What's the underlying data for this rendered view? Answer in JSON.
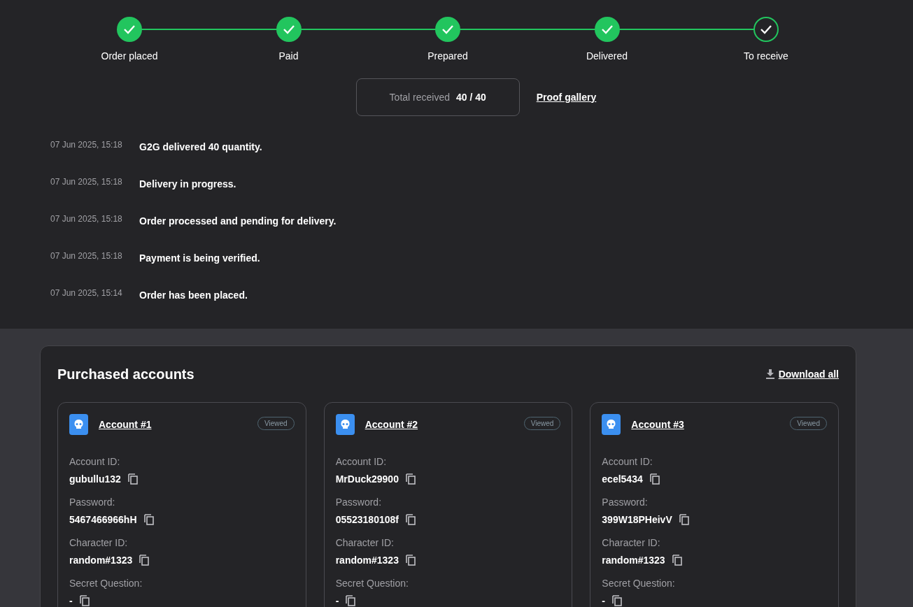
{
  "steps": [
    {
      "label": "Order placed",
      "kind": "filled"
    },
    {
      "label": "Paid",
      "kind": "filled"
    },
    {
      "label": "Prepared",
      "kind": "filled"
    },
    {
      "label": "Delivered",
      "kind": "filled"
    },
    {
      "label": "To receive",
      "kind": "outlined"
    }
  ],
  "total": {
    "label": "Total received",
    "value": "40 / 40"
  },
  "proof_link": "Proof gallery",
  "timeline": [
    {
      "time": "07 Jun 2025, 15:18",
      "message": "G2G delivered 40 quantity."
    },
    {
      "time": "07 Jun 2025, 15:18",
      "message": "Delivery in progress."
    },
    {
      "time": "07 Jun 2025, 15:18",
      "message": "Order processed and pending for delivery."
    },
    {
      "time": "07 Jun 2025, 15:18",
      "message": "Payment is being verified."
    },
    {
      "time": "07 Jun 2025, 15:14",
      "message": "Order has been placed."
    }
  ],
  "purchased": {
    "title": "Purchased accounts",
    "download": "Download all",
    "accounts": [
      {
        "title": "Account #1",
        "badge": "Viewed",
        "fields": [
          {
            "label": "Account ID:",
            "value": "gubullu132"
          },
          {
            "label": "Password:",
            "value": "5467466966hH"
          },
          {
            "label": "Character ID:",
            "value": "random#1323"
          },
          {
            "label": "Secret Question:",
            "value": "-"
          }
        ]
      },
      {
        "title": "Account #2",
        "badge": "Viewed",
        "fields": [
          {
            "label": "Account ID:",
            "value": "MrDuck29900"
          },
          {
            "label": "Password:",
            "value": "05523180108f"
          },
          {
            "label": "Character ID:",
            "value": "random#1323"
          },
          {
            "label": "Secret Question:",
            "value": "-"
          }
        ]
      },
      {
        "title": "Account #3",
        "badge": "Viewed",
        "fields": [
          {
            "label": "Account ID:",
            "value": "ecel5434"
          },
          {
            "label": "Password:",
            "value": "399W18PHeivV"
          },
          {
            "label": "Character ID:",
            "value": "random#1323"
          },
          {
            "label": "Secret Question:",
            "value": "-"
          }
        ]
      }
    ]
  }
}
